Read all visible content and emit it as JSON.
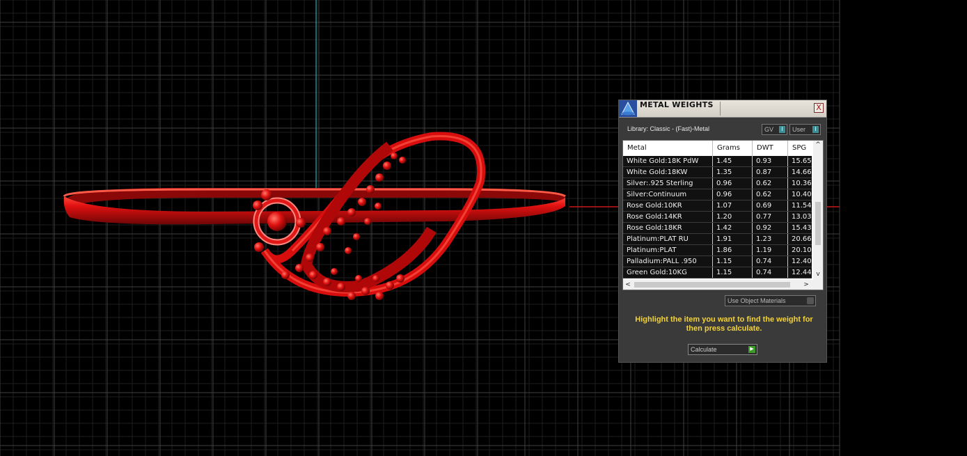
{
  "panel": {
    "title": "METAL WEIGHTS",
    "close_glyph": "X",
    "library_label": "Library: Classic - (Fast)-Metal",
    "gv_label": "GV",
    "user_label": "User",
    "toggle_knob_glyph": "I",
    "headers": [
      "Metal",
      "Grams",
      "DWT",
      "SPG"
    ],
    "rows": [
      [
        "White Gold:18K PdW",
        "1.45",
        "0.93",
        "15.65"
      ],
      [
        "White Gold:18KW",
        "1.35",
        "0.87",
        "14.66"
      ],
      [
        "Silver:.925 Sterling",
        "0.96",
        "0.62",
        "10.36"
      ],
      [
        "Silver:Continuum",
        "0.96",
        "0.62",
        "10.40"
      ],
      [
        "Rose Gold:10KR",
        "1.07",
        "0.69",
        "11.54"
      ],
      [
        "Rose Gold:14KR",
        "1.20",
        "0.77",
        "13.03"
      ],
      [
        "Rose Gold:18KR",
        "1.42",
        "0.92",
        "15.43"
      ],
      [
        "Platinum:PLAT RU",
        "1.91",
        "1.23",
        "20.66"
      ],
      [
        "Platinum:PLAT",
        "1.86",
        "1.19",
        "20.10"
      ],
      [
        "Palladium:PALL .950",
        "1.15",
        "0.74",
        "12.40"
      ],
      [
        "Green Gold:10KG",
        "1.15",
        "0.74",
        "12.44"
      ]
    ],
    "use_object_label": "Use Object Materials",
    "hint_text": "Highlight the item you want to find the weight for then press calculate.",
    "calculate_label": "Calculate",
    "calc_knob_glyph": "▶",
    "scroll_up_glyph": "^",
    "scroll_down_glyph": "v",
    "scroll_left_glyph": "<",
    "scroll_right_glyph": ">"
  },
  "colors": {
    "background": "#000000",
    "grid": "#3f3f3f",
    "axis_vertical": "#2fa7b5",
    "axis_horizontal": "#c81818",
    "ring": "#e01010",
    "hint": "#f2d23a"
  }
}
